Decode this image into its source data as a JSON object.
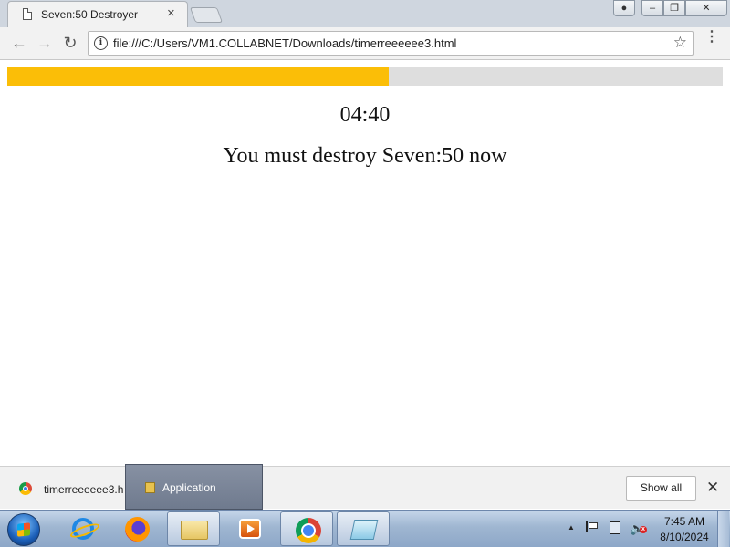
{
  "browser": {
    "tab_title": "Seven:50 Destroyer",
    "tab_close": "×",
    "url": "file:///C:/Users/VM1.COLLABNET/Downloads/timerreeeeee3.html",
    "nav_back": "←",
    "nav_forward": "→",
    "nav_reload": "↻",
    "star": "☆",
    "menu": "⋮",
    "window_close": "✕"
  },
  "page": {
    "progress_fraction": 0.533,
    "progress_color": "#fbbe07",
    "timer": "04:40",
    "message": "You must destroy Seven:50 now"
  },
  "download_bar": {
    "filename": "timerreeeeee3.h",
    "show_all": "Show all",
    "close": "✕"
  },
  "taskbar_tooltip": {
    "label": "Application"
  },
  "taskbar": {
    "clock_time": "7:45 AM",
    "clock_date": "8/10/2024",
    "pinned": [
      "start-orb-icon",
      "internet-explorer-icon",
      "firefox-icon",
      "file-explorer-icon",
      "media-player-icon",
      "chrome-icon",
      "notepad-icon"
    ]
  }
}
